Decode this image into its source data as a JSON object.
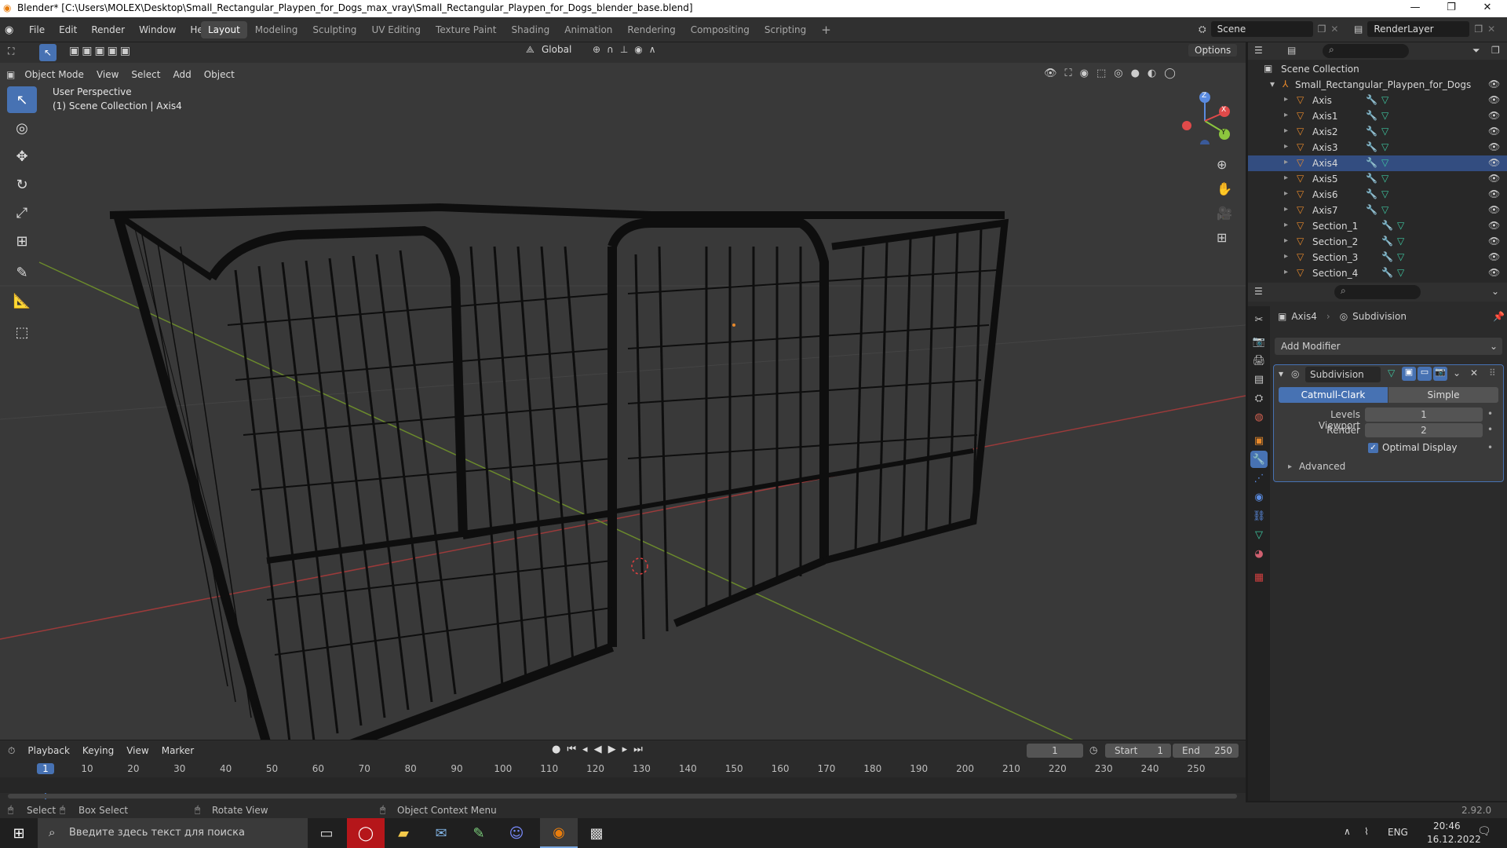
{
  "window": {
    "title": "Blender* [C:\\Users\\MOLEX\\Desktop\\Small_Rectangular_Playpen_for_Dogs_max_vray\\Small_Rectangular_Playpen_for_Dogs_blender_base.blend]",
    "minimize": "—",
    "maximize": "❐",
    "close": "✕"
  },
  "menu": [
    "File",
    "Edit",
    "Render",
    "Window",
    "Help"
  ],
  "workspaces": [
    {
      "label": "Layout",
      "active": true
    },
    {
      "label": "Modeling"
    },
    {
      "label": "Sculpting"
    },
    {
      "label": "UV Editing"
    },
    {
      "label": "Texture Paint"
    },
    {
      "label": "Shading"
    },
    {
      "label": "Animation"
    },
    {
      "label": "Rendering"
    },
    {
      "label": "Compositing"
    },
    {
      "label": "Scripting"
    }
  ],
  "add_workspace": "+",
  "scene": {
    "name": "Scene",
    "render_layer": "RenderLayer"
  },
  "viewport": {
    "mode": "Object Mode",
    "menus": [
      "View",
      "Select",
      "Add",
      "Object"
    ],
    "orientation": "Global",
    "options": "Options",
    "info_line1": "User Perspective",
    "info_line2": "(1) Scene Collection | Axis4",
    "gizmo": {
      "z": "Z",
      "y": "Y",
      "x": "X"
    }
  },
  "outliner": {
    "root": "Scene Collection",
    "collection": "Small_Rectangular_Playpen_for_Dogs",
    "items": [
      "Axis",
      "Axis1",
      "Axis2",
      "Axis3",
      "Axis4",
      "Axis5",
      "Axis6",
      "Axis7",
      "Section_1",
      "Section_2",
      "Section_3",
      "Section_4"
    ],
    "selected": "Axis4"
  },
  "properties": {
    "object": "Axis4",
    "modifier_crumb": "Subdivision",
    "add_modifier": "Add Modifier",
    "modifier_name": "Subdivision",
    "method_active": "Catmull-Clark",
    "method_other": "Simple",
    "levels_viewport_label": "Levels Viewport",
    "levels_viewport": "1",
    "render_label": "Render",
    "render": "2",
    "optimal_display": "Optimal Display",
    "advanced": "Advanced"
  },
  "timeline": {
    "menus": [
      "Playback",
      "Keying",
      "View",
      "Marker"
    ],
    "current_frame": "1",
    "start_label": "Start",
    "start": "1",
    "end_label": "End",
    "end": "250",
    "ticks": [
      "1",
      "10",
      "20",
      "30",
      "40",
      "50",
      "60",
      "70",
      "80",
      "90",
      "100",
      "110",
      "120",
      "130",
      "140",
      "150",
      "160",
      "170",
      "180",
      "190",
      "200",
      "210",
      "220",
      "230",
      "240",
      "250"
    ]
  },
  "status": {
    "select": "Select",
    "box_select": "Box Select",
    "rotate_view": "Rotate View",
    "context_menu": "Object Context Menu",
    "version": "2.92.0"
  },
  "taskbar": {
    "search_placeholder": "Введите здесь текст для поиска",
    "lang": "ENG",
    "time": "20:46",
    "date": "16.12.2022"
  },
  "colors": {
    "accent": "#4772b3",
    "object_orange": "#e8892b",
    "mesh_green": "#3ec6a0"
  }
}
